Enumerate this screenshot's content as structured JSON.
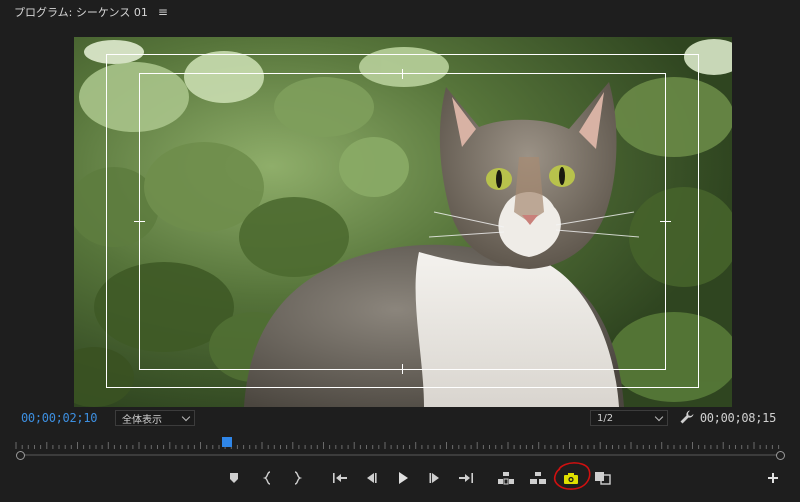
{
  "panel": {
    "title": "プログラム: シーケンス 01",
    "menu_icon": "hamburger-menu-icon"
  },
  "monitor": {
    "content": "cat sitting in front of green foliage",
    "safe_margins": true
  },
  "timecode": {
    "current": "00;00;02;10",
    "duration": "00;00;08;15",
    "current_color": "#3d8fe0"
  },
  "zoom": {
    "selected": "全体表示"
  },
  "resolution": {
    "selected": "1/2"
  },
  "transport": {
    "buttons": [
      {
        "name": "add-marker-button",
        "icon": "marker-icon"
      },
      {
        "name": "mark-in-button",
        "icon": "brace-left-icon"
      },
      {
        "name": "mark-out-button",
        "icon": "brace-right-icon"
      },
      {
        "name": "go-to-in-button",
        "icon": "go-to-in-icon"
      },
      {
        "name": "step-back-button",
        "icon": "step-back-icon"
      },
      {
        "name": "play-button",
        "icon": "play-icon"
      },
      {
        "name": "step-forward-button",
        "icon": "step-forward-icon"
      },
      {
        "name": "go-to-out-button",
        "icon": "go-to-out-icon"
      },
      {
        "name": "lift-button",
        "icon": "lift-icon"
      },
      {
        "name": "extract-button",
        "icon": "extract-icon"
      },
      {
        "name": "export-frame-button",
        "icon": "camera-icon",
        "highlighted": true
      },
      {
        "name": "compare-view-button",
        "icon": "compare-icon"
      },
      {
        "name": "button-editor-button",
        "icon": "plus-icon"
      }
    ],
    "highlight_color": "#e0e000",
    "annotation_color": "#d01010"
  },
  "playhead": {
    "position_fraction": 0.27
  }
}
